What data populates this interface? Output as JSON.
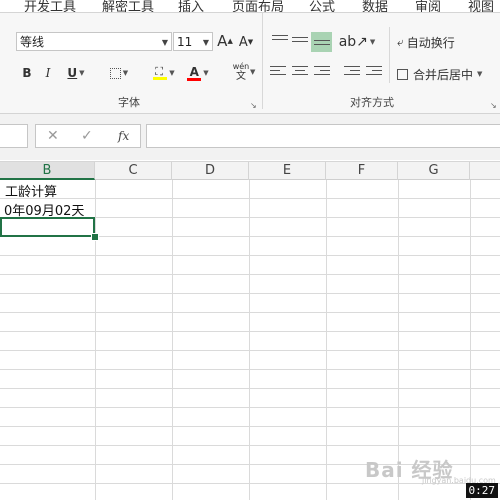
{
  "tabs": [
    "开发工具",
    "解密工具",
    "插入",
    "页面布局",
    "公式",
    "数据",
    "审阅",
    "视图"
  ],
  "ribbon": {
    "font_name": "等线",
    "font_size": "11",
    "grow_font": "A",
    "shrink_font": "A",
    "bold": "B",
    "italic": "I",
    "underline": "U",
    "phonetic_top": "wén",
    "phonetic_bottom": "文",
    "wrap_text": "自动换行",
    "merge_center": "合并后居中",
    "font_group_label": "字体",
    "align_group_label": "对齐方式",
    "accent_color": "#217346",
    "highlight_color": "#ffff00",
    "font_color": "#ff0000"
  },
  "formula_bar": {
    "cancel": "✕",
    "enter": "✓",
    "fx": "fx",
    "value": ""
  },
  "sheet": {
    "columns": [
      "B",
      "C",
      "D",
      "E",
      "F",
      "G"
    ],
    "active_column": "B",
    "cells": {
      "b1": "工龄计算",
      "b2": "0年09月02天"
    }
  },
  "overlay": {
    "timer": "0:27",
    "watermark": "Bai 经验",
    "watermark_sub": "jingyan.baidu.com"
  }
}
